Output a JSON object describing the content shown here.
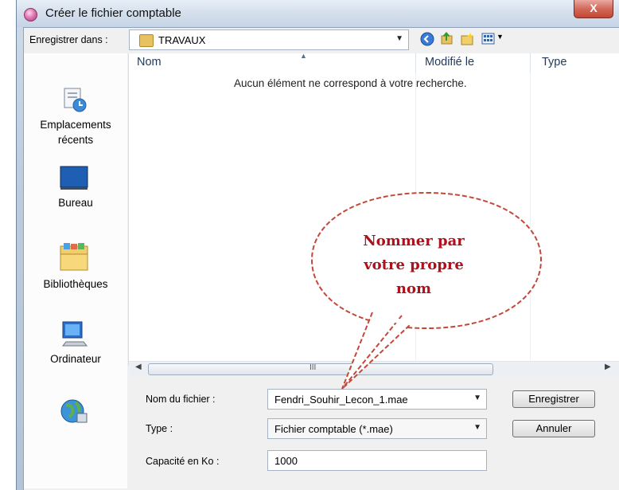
{
  "window": {
    "title": "Créer le fichier comptable",
    "close_label": "X"
  },
  "toolbar": {
    "save_in_label": "Enregistrer dans :",
    "folder": "TRAVAUX"
  },
  "places": [
    {
      "label": "Emplacements\nrécents",
      "icon": "recent-places-icon"
    },
    {
      "label": "Bureau",
      "icon": "desktop-icon"
    },
    {
      "label": "Bibliothèques",
      "icon": "libraries-icon"
    },
    {
      "label": "Ordinateur",
      "icon": "computer-icon"
    },
    {
      "label": "",
      "icon": "network-icon"
    }
  ],
  "file_list": {
    "columns": [
      "Nom",
      "Modifié le",
      "Type"
    ],
    "empty_message": "Aucun élément ne correspond à votre recherche.",
    "scroll_mark": "III"
  },
  "form": {
    "filename_label": "Nom du fichier :",
    "filename_value": "Fendri_Souhir_Lecon_1.mae",
    "type_label": "Type :",
    "type_value": "Fichier comptable (*.mae)",
    "capacity_label": "Capacité en Ko :",
    "capacity_value": "1000"
  },
  "buttons": {
    "save": "Enregistrer",
    "cancel": "Annuler"
  },
  "callout": {
    "lines": [
      "Nommer par",
      "votre propre",
      "nom"
    ],
    "color": "#b0101b"
  }
}
